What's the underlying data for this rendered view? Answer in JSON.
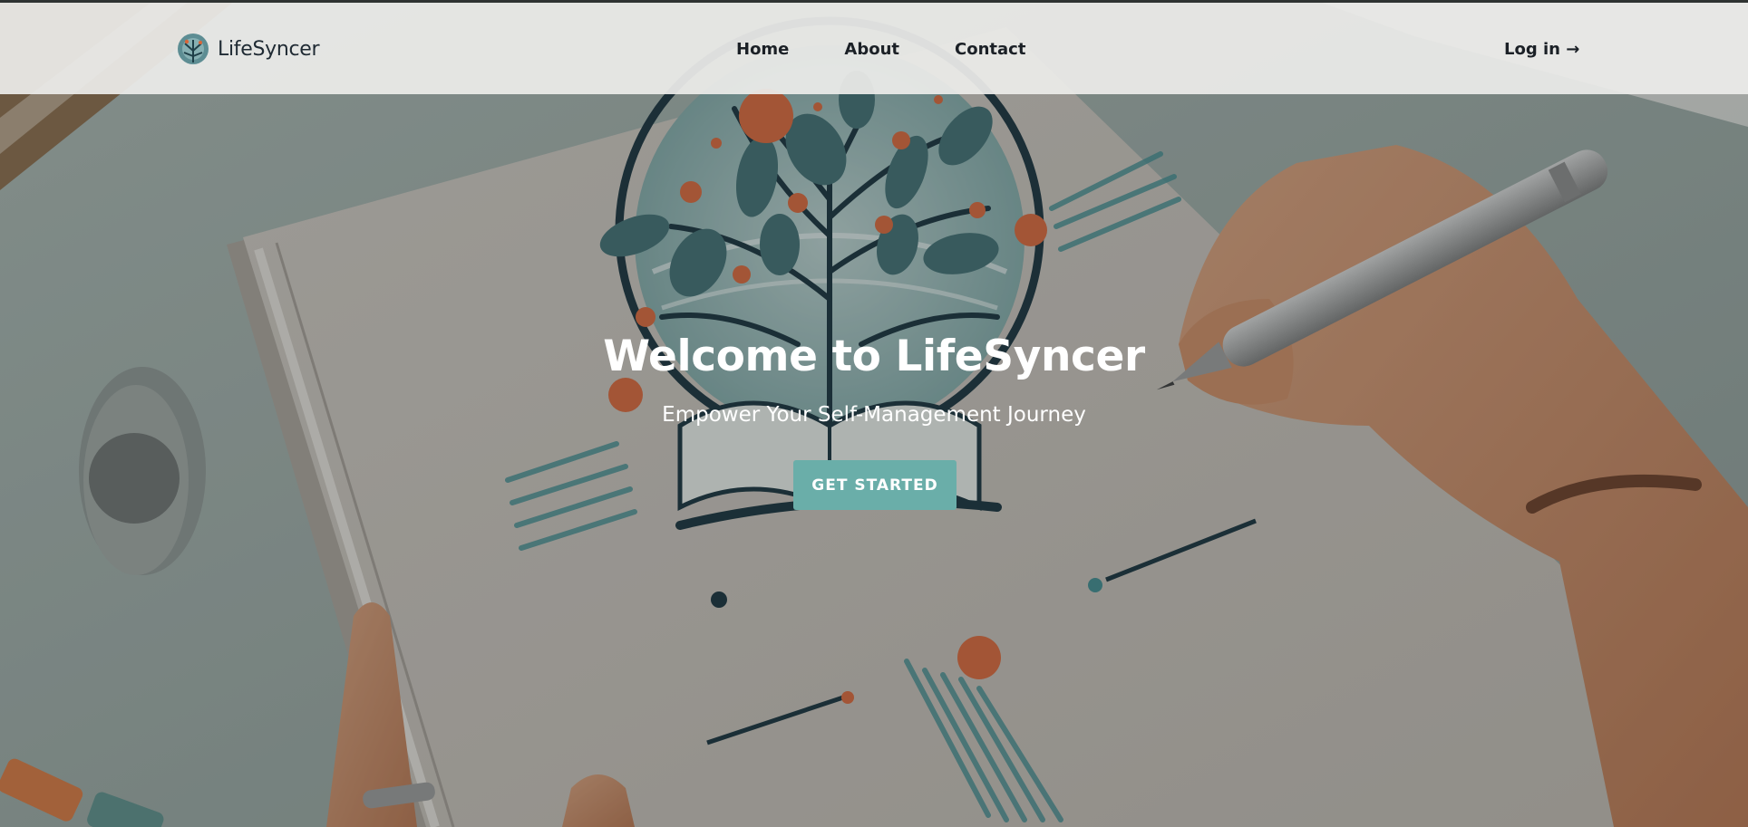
{
  "header": {
    "brand_name": "LifeSyncer",
    "nav": {
      "home": "Home",
      "about": "About",
      "contact": "Contact"
    },
    "login_label": "Log in →"
  },
  "hero": {
    "title": "Welcome to LifeSyncer",
    "subtitle": "Empower Your Self-Management Journey",
    "cta_label": "GET STARTED",
    "illustration_wordmark": "LifeSyncer"
  },
  "colors": {
    "accent": "#6aaea9",
    "header_bg": "#ecece a",
    "text_dark": "#1b2026",
    "orange": "#d8663a",
    "teal_dark": "#1f3f48"
  }
}
